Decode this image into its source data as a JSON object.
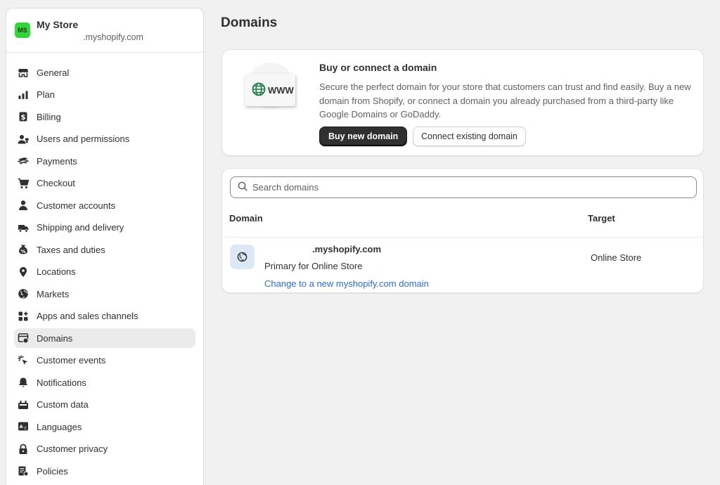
{
  "store": {
    "avatar_initials": "MS",
    "avatar_color": "#36d43c",
    "name": "My Store",
    "domain_suffix": ".myshopify.com"
  },
  "sidebar": {
    "items": [
      {
        "label": "General",
        "icon": "store-icon"
      },
      {
        "label": "Plan",
        "icon": "plan-icon"
      },
      {
        "label": "Billing",
        "icon": "billing-icon"
      },
      {
        "label": "Users and permissions",
        "icon": "users-icon"
      },
      {
        "label": "Payments",
        "icon": "payments-icon"
      },
      {
        "label": "Checkout",
        "icon": "cart-icon"
      },
      {
        "label": "Customer accounts",
        "icon": "person-icon"
      },
      {
        "label": "Shipping and delivery",
        "icon": "truck-icon"
      },
      {
        "label": "Taxes and duties",
        "icon": "tax-icon"
      },
      {
        "label": "Locations",
        "icon": "location-pin-icon"
      },
      {
        "label": "Markets",
        "icon": "globe-icon"
      },
      {
        "label": "Apps and sales channels",
        "icon": "apps-icon"
      },
      {
        "label": "Domains",
        "icon": "domains-icon",
        "active": true
      },
      {
        "label": "Customer events",
        "icon": "cursor-click-icon"
      },
      {
        "label": "Notifications",
        "icon": "bell-icon"
      },
      {
        "label": "Custom data",
        "icon": "custom-data-icon"
      },
      {
        "label": "Languages",
        "icon": "language-icon"
      },
      {
        "label": "Customer privacy",
        "icon": "lock-icon"
      },
      {
        "label": "Policies",
        "icon": "policies-icon"
      }
    ]
  },
  "page": {
    "title": "Domains"
  },
  "promo": {
    "illustration_text": "WWW",
    "title": "Buy or connect a domain",
    "description": "Secure the perfect domain for your store that customers can trust and find easily. Buy a new domain from Shopify, or connect a domain you already purchased from a third-party like Google Domains or GoDaddy.",
    "buy_label": "Buy new domain",
    "connect_label": "Connect existing domain"
  },
  "domains": {
    "search_placeholder": "Search domains",
    "columns": {
      "domain": "Domain",
      "target": "Target"
    },
    "rows": [
      {
        "domain_suffix": ".myshopify.com",
        "subtitle": "Primary for Online Store",
        "link": "Change to a new myshopify.com domain",
        "target": "Online Store"
      }
    ]
  },
  "colors": {
    "primary_button": "#303030",
    "link": "#2c6ecb",
    "row_icon_bg": "#dbe8f7"
  }
}
